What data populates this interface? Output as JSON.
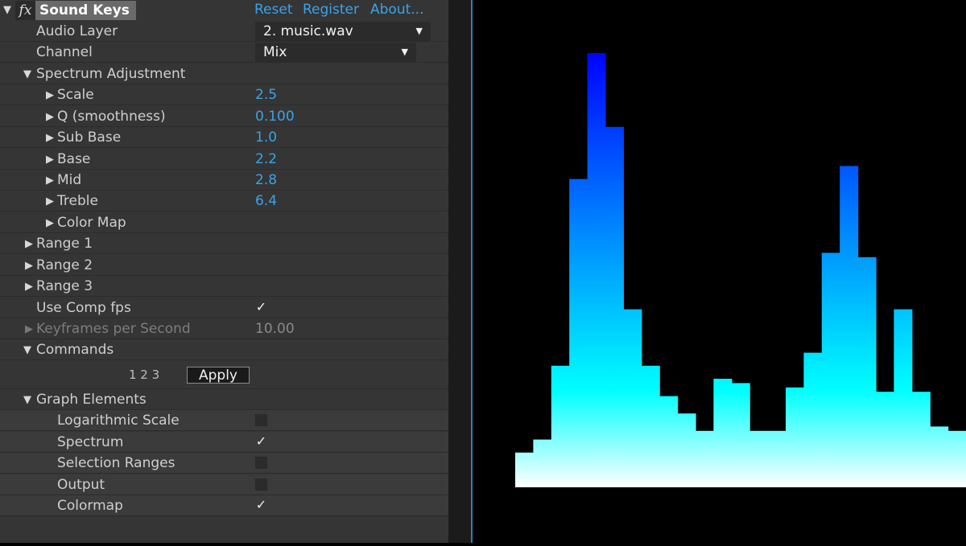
{
  "header": {
    "title": "Sound Keys",
    "fx": "fx",
    "links": [
      "Reset",
      "Register",
      "About..."
    ]
  },
  "params": {
    "audio_layer": {
      "label": "Audio Layer",
      "value": "2. music.wav"
    },
    "channel": {
      "label": "Channel",
      "value": "Mix"
    },
    "spectrum_adjustment": {
      "label": "Spectrum Adjustment"
    },
    "scale": {
      "label": "Scale",
      "value": "2.5"
    },
    "q": {
      "label": "Q (smoothness)",
      "value": "0.100"
    },
    "sub_base": {
      "label": "Sub Base",
      "value": "1.0"
    },
    "base": {
      "label": "Base",
      "value": "2.2"
    },
    "mid": {
      "label": "Mid",
      "value": "2.8"
    },
    "treble": {
      "label": "Treble",
      "value": "6.4"
    },
    "color_map": {
      "label": "Color Map"
    },
    "range1": {
      "label": "Range 1"
    },
    "range2": {
      "label": "Range 2"
    },
    "range3": {
      "label": "Range 3"
    },
    "use_comp_fps": {
      "label": "Use Comp fps",
      "checked": true
    },
    "keyframes": {
      "label": "Keyframes per Second",
      "value": "10.00"
    },
    "commands": {
      "label": "Commands",
      "icons": "1 2 3",
      "apply": "Apply"
    },
    "graph_elements": {
      "label": "Graph Elements"
    }
  },
  "graph_elements": [
    {
      "label": "Logarithmic Scale",
      "checked": false
    },
    {
      "label": "Spectrum",
      "checked": true
    },
    {
      "label": "Selection Ranges",
      "checked": false
    },
    {
      "label": "Output",
      "checked": false
    },
    {
      "label": "Colormap",
      "checked": true
    }
  ],
  "spectrum_values": [
    0.08,
    0.11,
    0.28,
    0.71,
    1.0,
    0.83,
    0.41,
    0.28,
    0.21,
    0.17,
    0.13,
    0.25,
    0.24,
    0.13,
    0.13,
    0.23,
    0.31,
    0.54,
    0.74,
    0.53,
    0.22,
    0.41,
    0.22,
    0.14,
    0.13
  ],
  "colors": {
    "accent": "#3aa3e6",
    "bar_top": "#0000ff",
    "bar_mid": "#00ffff",
    "bar_bottom": "#ffffff"
  }
}
